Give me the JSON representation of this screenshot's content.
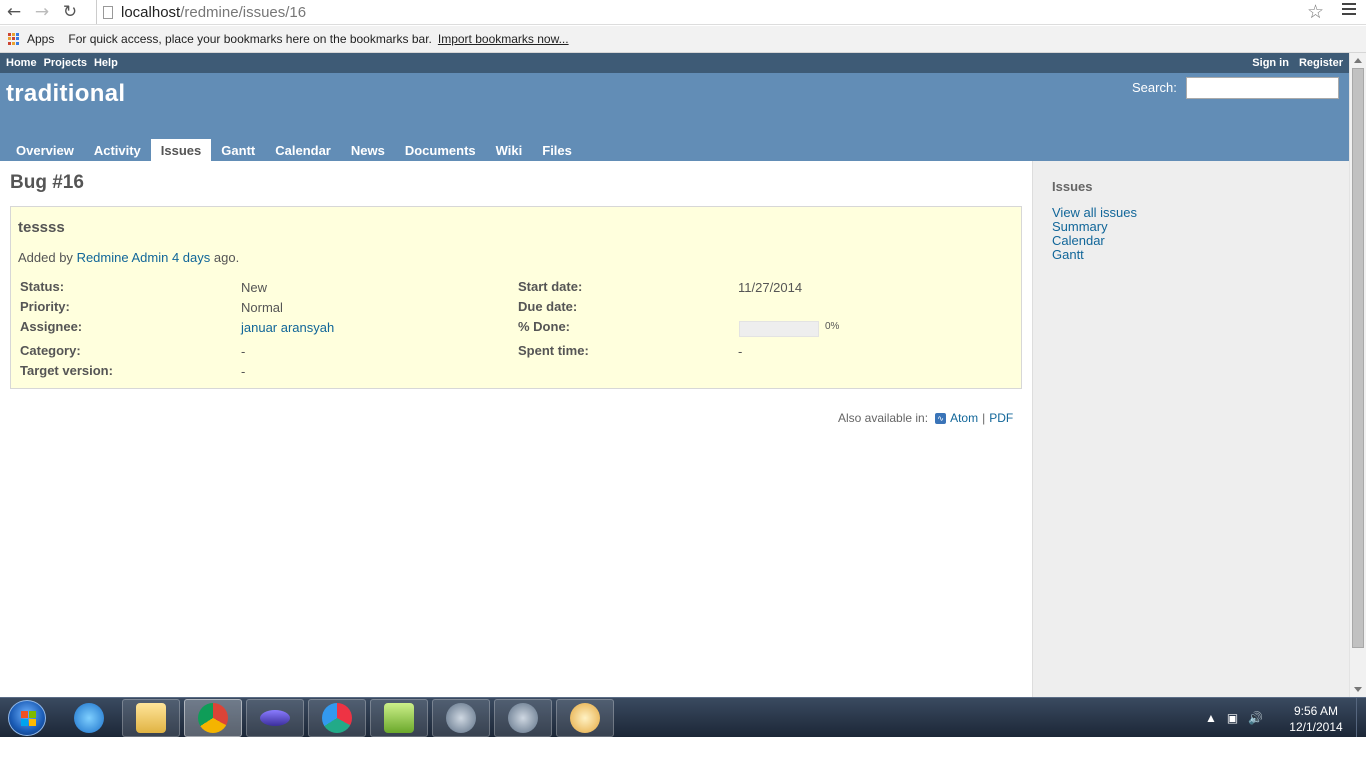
{
  "browser": {
    "url_host": "localhost",
    "url_path": "/redmine/issues/16",
    "bookmarks": {
      "apps_label": "Apps",
      "hint": "For quick access, place your bookmarks here on the bookmarks bar.",
      "import_link": "Import bookmarks now..."
    }
  },
  "top_menu": {
    "left": [
      "Home",
      "Projects",
      "Help"
    ],
    "sign_in": "Sign in",
    "register": "Register"
  },
  "header": {
    "project_title": "traditional",
    "search_label": "Search:",
    "search_value": ""
  },
  "tabs": [
    {
      "label": "Overview"
    },
    {
      "label": "Activity"
    },
    {
      "label": "Issues",
      "active": true
    },
    {
      "label": "Gantt"
    },
    {
      "label": "Calendar"
    },
    {
      "label": "News"
    },
    {
      "label": "Documents"
    },
    {
      "label": "Wiki"
    },
    {
      "label": "Files"
    }
  ],
  "issue": {
    "heading": "Bug #16",
    "subject": "tessss",
    "author_prefix": "Added by",
    "author": "Redmine Admin",
    "age": "4 days",
    "age_suffix": "ago.",
    "attributes": {
      "status_label": "Status:",
      "status": "New",
      "priority_label": "Priority:",
      "priority": "Normal",
      "assignee_label": "Assignee:",
      "assignee": "januar aransyah",
      "category_label": "Category:",
      "category": "-",
      "target_label": "Target version:",
      "target": "-",
      "start_label": "Start date:",
      "start": "11/27/2014",
      "due_label": "Due date:",
      "due": "",
      "done_label": "% Done:",
      "done_text": "0%",
      "done_fraction": 0,
      "spent_label": "Spent time:",
      "spent": "-"
    }
  },
  "other_formats": {
    "label": "Also available in:",
    "atom": "Atom",
    "separator": "|",
    "pdf": "PDF"
  },
  "sidebar": {
    "title": "Issues",
    "links": [
      "View all issues",
      "Summary",
      "Calendar",
      "Gantt"
    ]
  },
  "taskbar": {
    "time": "9:56 AM",
    "date": "12/1/2014"
  },
  "colors": {
    "top_menu_bg": "#3e5b76",
    "header_bg": "#628db6",
    "link": "#116699",
    "issue_bg": "#ffffdd"
  }
}
